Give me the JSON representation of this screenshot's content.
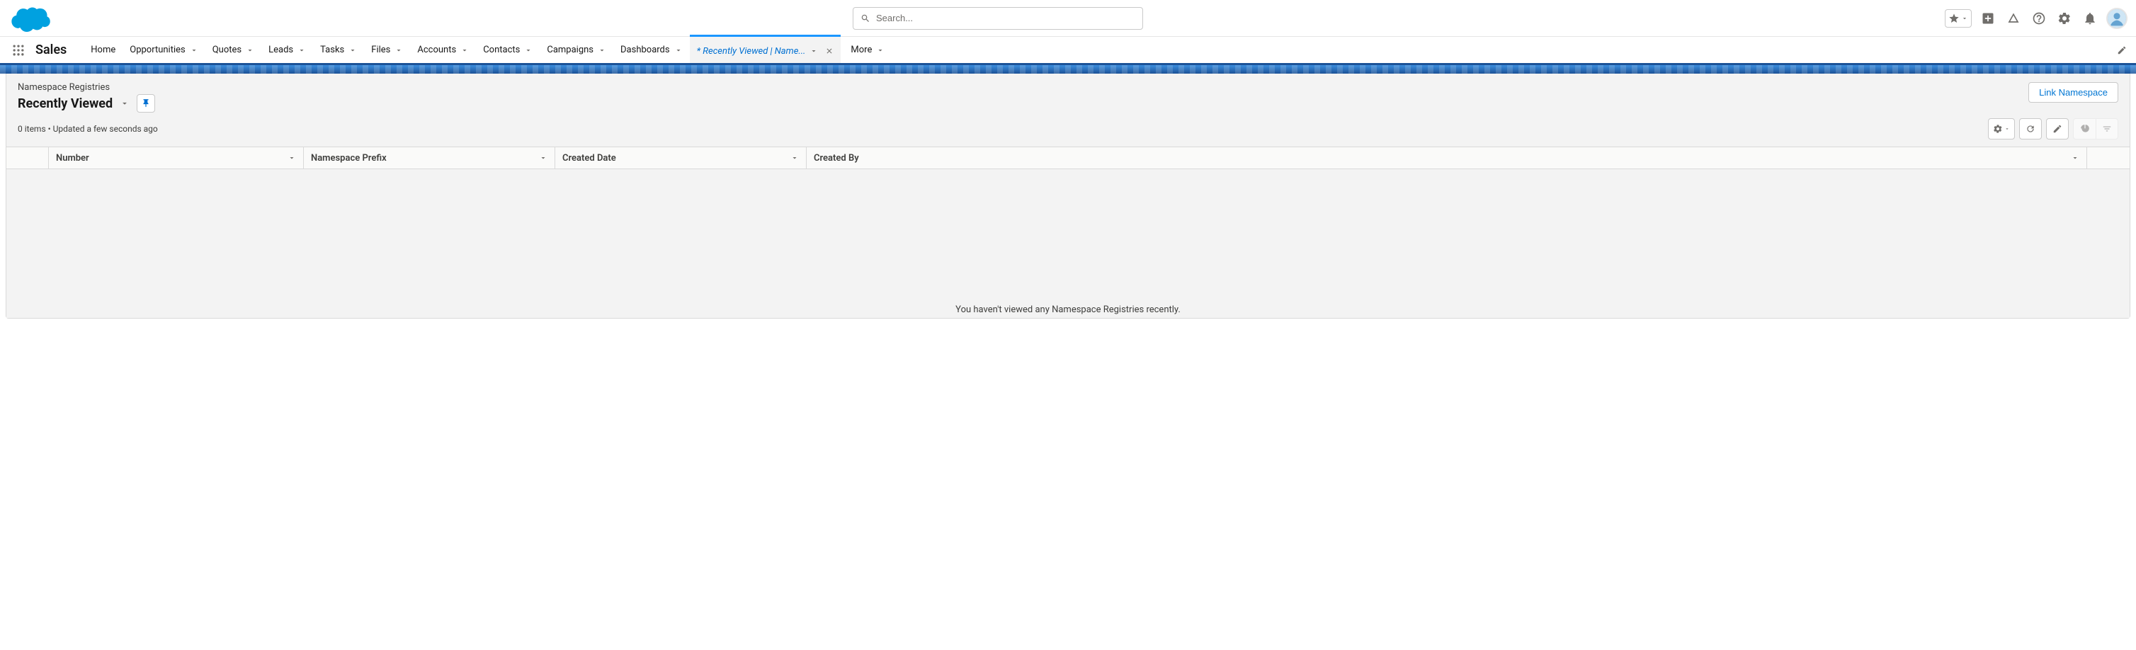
{
  "header": {
    "search_placeholder": "Search..."
  },
  "nav": {
    "app_name": "Sales",
    "items": [
      {
        "label": "Home",
        "dropdown": false
      },
      {
        "label": "Opportunities",
        "dropdown": true
      },
      {
        "label": "Quotes",
        "dropdown": true
      },
      {
        "label": "Leads",
        "dropdown": true
      },
      {
        "label": "Tasks",
        "dropdown": true
      },
      {
        "label": "Files",
        "dropdown": true
      },
      {
        "label": "Accounts",
        "dropdown": true
      },
      {
        "label": "Contacts",
        "dropdown": true
      },
      {
        "label": "Campaigns",
        "dropdown": true
      },
      {
        "label": "Dashboards",
        "dropdown": true
      }
    ],
    "active_tab": "* Recently Viewed | Name...",
    "more_label": "More"
  },
  "page": {
    "object_label": "Namespace Registries",
    "view_name": "Recently Viewed",
    "action_button": "Link Namespace",
    "meta": "0 items • Updated a few seconds ago",
    "columns": [
      "Number",
      "Namespace Prefix",
      "Created Date",
      "Created By"
    ],
    "empty_message": "You haven't viewed any Namespace Registries recently."
  }
}
